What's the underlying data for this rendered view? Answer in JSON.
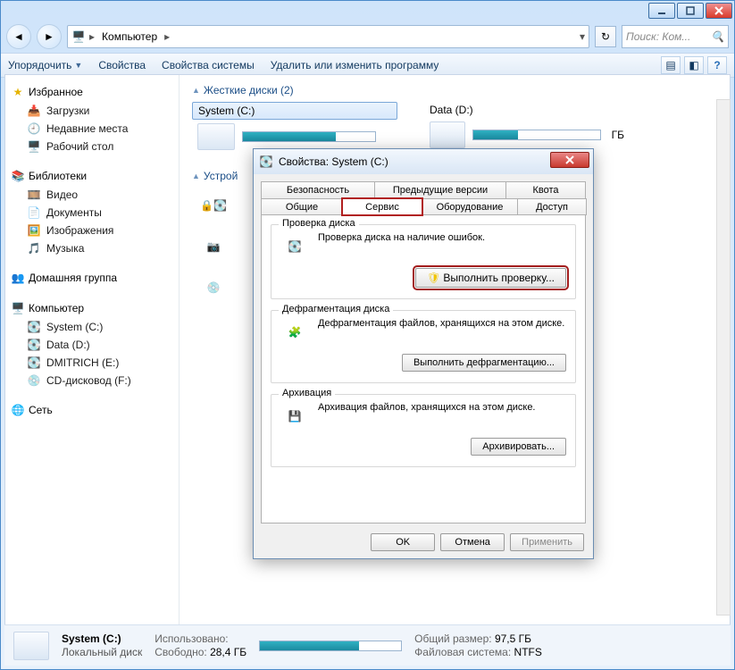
{
  "address": {
    "root_icon": "computer",
    "seg1": "Компьютер",
    "search_placeholder": "Поиск: Ком..."
  },
  "toolbar": {
    "organize": "Упорядочить",
    "properties": "Свойства",
    "system_properties": "Свойства системы",
    "programs": "Удалить или изменить программу"
  },
  "sidebar": {
    "favorites": "Избранное",
    "fav_items": [
      "Загрузки",
      "Недавние места",
      "Рабочий стол"
    ],
    "libraries": "Библиотеки",
    "lib_items": [
      "Видео",
      "Документы",
      "Изображения",
      "Музыка"
    ],
    "homegroup": "Домашняя группа",
    "computer": "Компьютер",
    "comp_items": [
      "System (C:)",
      "Data (D:)",
      "DMITRICH (E:)",
      "CD-дисковод (F:)"
    ],
    "network": "Сеть"
  },
  "main": {
    "hdds_title": "Жесткие диски (2)",
    "devices_title": "Устрой",
    "drive1": "System (C:)",
    "drive2": "Data (D:)",
    "drive2_size": "ГБ"
  },
  "dialog": {
    "title": "Свойства: System (C:)",
    "tabs_row1": [
      "Безопасность",
      "Предыдущие версии",
      "Квота"
    ],
    "tabs_row2": [
      "Общие",
      "Сервис",
      "Оборудование",
      "Доступ"
    ],
    "g1_title": "Проверка диска",
    "g1_text": "Проверка диска на наличие ошибок.",
    "g1_btn": "Выполнить проверку...",
    "g2_title": "Дефрагментация диска",
    "g2_text": "Дефрагментация файлов, хранящихся на этом диске.",
    "g2_btn": "Выполнить дефрагментацию...",
    "g3_title": "Архивация",
    "g3_text": "Архивация файлов, хранящихся на этом диске.",
    "g3_btn": "Архивировать...",
    "ok": "OK",
    "cancel": "Отмена",
    "apply": "Применить"
  },
  "status": {
    "drive": "System (C:)",
    "type": "Локальный диск",
    "used_l": "Использовано:",
    "free_l": "Свободно:",
    "free_v": "28,4 ГБ",
    "total_l": "Общий размер:",
    "total_v": "97,5 ГБ",
    "fs_l": "Файловая система:",
    "fs_v": "NTFS"
  }
}
